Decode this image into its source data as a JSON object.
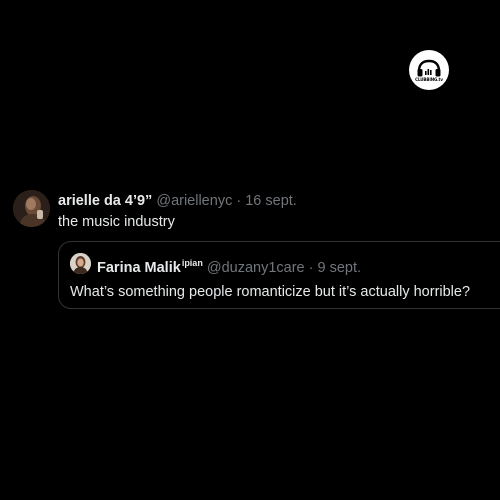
{
  "brand": {
    "logo_icon": "headphones-icon",
    "logo_text": "CLUBBING.tv"
  },
  "tweet": {
    "author_name": "arielle da 4’9”",
    "handle": "@ariellenyc",
    "separator": "·",
    "date": "16 sept.",
    "text": "the music industry",
    "quote": {
      "author_name": "Farina Malik",
      "author_suffix": "ipian",
      "handle": "@duzany1care",
      "separator": "·",
      "date": "9 sept.",
      "text": "What’s something people romanticize but it’s actually horrible?"
    }
  },
  "colors": {
    "background": "#000000",
    "primary_text": "#e7e9ea",
    "secondary_text": "#71767b",
    "card_border": "#2f3336"
  }
}
